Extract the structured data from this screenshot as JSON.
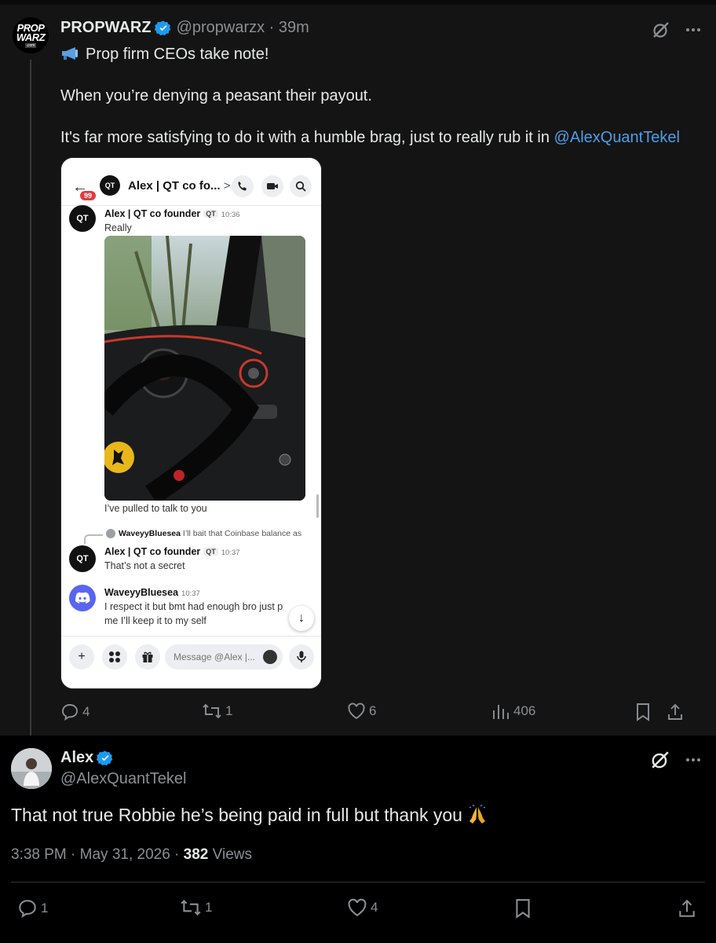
{
  "parent_tweet": {
    "author_name": "PROPWARZ",
    "handle": "@propwarzx",
    "time": "39m",
    "avatar_logo": [
      "PROP",
      "WARZ"
    ],
    "avatar_logo_sub": ".com",
    "line1": "Prop firm CEOs take note!",
    "line2": "When you’re denying a peasant their payout.",
    "line3_text": "It's far more satisfying to do it with a humble brag, just to really rub it in ",
    "line3_mention": "@AlexQuantTekel",
    "metrics": {
      "replies": "4",
      "retweets": "1",
      "likes": "6",
      "views": "406"
    }
  },
  "screenshot": {
    "badge": "99",
    "header_avatar": "QT",
    "header_title": "Alex | QT co fo...",
    "header_chevron": ">",
    "msg1": {
      "avatar": "QT",
      "name": "Alex | QT co founder",
      "tag": "QT",
      "time": "10:36",
      "text": "Really"
    },
    "image_caption": "I’ve pulled to talk to you",
    "reply_preview": {
      "name": "WaveyyBluesea",
      "text": "I’ll bait that Coinbase balance as"
    },
    "msg2": {
      "avatar": "QT",
      "name": "Alex | QT co founder",
      "tag": "QT",
      "time": "10:37",
      "text": "That’s not a secret"
    },
    "msg3": {
      "name": "WaveyyBluesea",
      "time": "10:37",
      "text_line1": "I respect it but bmt had enough bro just p",
      "text_line2": "me I’ll keep it to my self"
    },
    "input_placeholder": "Message @Alex |..."
  },
  "reply_tweet": {
    "author_name": "Alex",
    "handle": "@AlexQuantTekel",
    "text": "That not true Robbie he’s being paid in full but thank you",
    "meta_time": "3:38 PM · May 31, 2026 · ",
    "views_count": "382",
    "views_label": " Views",
    "metrics": {
      "replies": "1",
      "retweets": "1",
      "likes": "4"
    }
  },
  "colors": {
    "accent": "#1d9bf0",
    "mention": "#4a9fe8",
    "muted": "#8b8f94",
    "discord": "#5865f2",
    "badge_red": "#e23a3f"
  },
  "icons": [
    "verified-badge-icon",
    "grok-icon",
    "more-icon",
    "megaphone-icon",
    "reply-icon",
    "retweet-icon",
    "like-icon",
    "views-icon",
    "bookmark-icon",
    "share-icon",
    "pray-emoji-icon"
  ]
}
